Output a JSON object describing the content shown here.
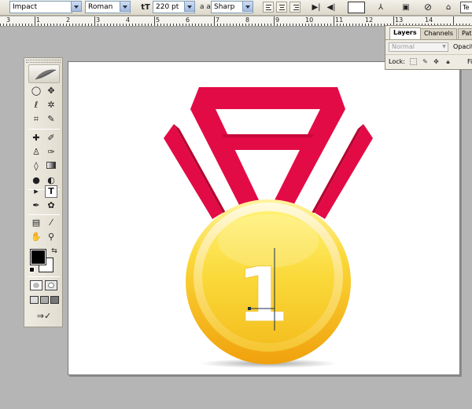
{
  "options_bar": {
    "font_family": "Impact",
    "font_style": "Roman",
    "font_size": "220 pt",
    "aa_label": "a a",
    "anti_alias": "Sharp",
    "font_size_icon": "tT"
  },
  "ruler": {
    "top_labels": [
      "3",
      "1",
      "2",
      "3",
      "4",
      "5",
      "6",
      "7",
      "8",
      "9",
      "10",
      "11",
      "12",
      "13",
      "14"
    ]
  },
  "layers_panel": {
    "tabs": [
      "Layers",
      "Channels",
      "Path"
    ],
    "blend_mode": "Normal",
    "opacity_label": "Opacit",
    "lock_label": "Lock:",
    "fill_label": "Fi"
  },
  "artwork": {
    "digit": "1"
  },
  "colors": {
    "ribbon_red": "#e30b45",
    "ribbon_dark": "#c00838",
    "gold_light": "#fff170",
    "gold_mid": "#f9cb2a",
    "gold_dark": "#f0a10d",
    "workspace": "#b5b5b5"
  },
  "icons": {
    "tools": [
      "marquee-icon",
      "move-icon",
      "lasso-icon",
      "magic-wand-icon",
      "crop-icon",
      "slice-icon",
      "healing-icon",
      "brush-icon",
      "stamp-icon",
      "history-brush-icon",
      "eraser-icon",
      "gradient-icon",
      "blur-icon",
      "dodge-icon",
      "path-select-icon",
      "type-icon",
      "pen-icon",
      "shape-icon",
      "notes-icon",
      "eyedropper-icon",
      "hand-icon",
      "zoom-icon"
    ]
  }
}
